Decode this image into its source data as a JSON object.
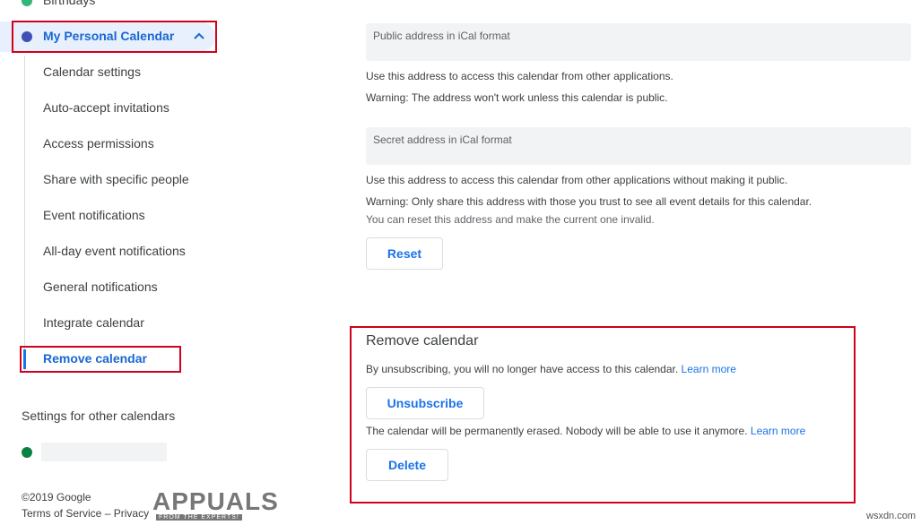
{
  "sidebar": {
    "top_calendar": {
      "label": "Birthdays",
      "color": "#33b679"
    },
    "current_calendar": {
      "label": "My Personal Calendar",
      "color": "#3f51b5"
    },
    "items": [
      {
        "label": "Calendar settings"
      },
      {
        "label": "Auto-accept invitations"
      },
      {
        "label": "Access permissions"
      },
      {
        "label": "Share with specific people"
      },
      {
        "label": "Event notifications"
      },
      {
        "label": "All-day event notifications"
      },
      {
        "label": "General notifications"
      },
      {
        "label": "Integrate calendar"
      },
      {
        "label": "Remove calendar",
        "active": true
      }
    ],
    "other_section_title": "Settings for other calendars",
    "other_calendar_color": "#0b8043"
  },
  "main": {
    "public_address_label": "Public address in iCal format",
    "public_note_1": "Use this address to access this calendar from other applications.",
    "public_note_2": "Warning: The address won't work unless this calendar is public.",
    "secret_address_label": "Secret address in iCal format",
    "secret_note_1": "Use this address to access this calendar from other applications without making it public.",
    "secret_note_2": "Warning: Only share this address with those you trust to see all event details for this calendar.",
    "secret_note_3": "You can reset this address and make the current one invalid.",
    "reset_label": "Reset",
    "remove": {
      "title": "Remove calendar",
      "unsubscribe_text": "By unsubscribing, you will no longer have access to this calendar.",
      "learn_more_1": "Learn more",
      "unsubscribe_label": "Unsubscribe",
      "delete_text": "The calendar will be permanently erased. Nobody will be able to use it anymore.",
      "learn_more_2": "Learn more",
      "delete_label": "Delete"
    }
  },
  "footer": {
    "copyright": "©2019 Google",
    "terms": "Terms of Service",
    "separator": "–",
    "privacy": "Privacy"
  },
  "watermarks": {
    "appuals": "APPUALS",
    "appuals_tagline": "FROM THE EXPERTS!",
    "site": "wsxdn.com"
  },
  "colors": {
    "accent": "#1a73e8",
    "highlight_box": "#d0021b"
  }
}
